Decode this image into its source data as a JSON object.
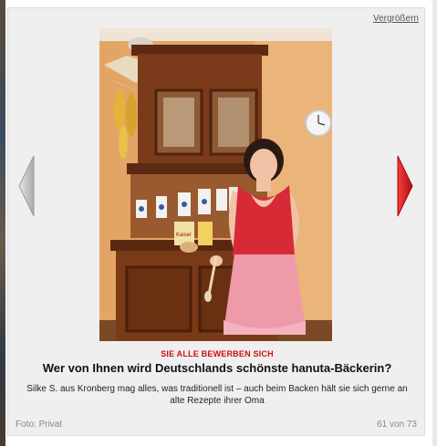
{
  "gallery": {
    "enlarge_label": "Vergrößern",
    "kicker": "SIE ALLE BEWERBEN SICH",
    "title": "Wer von Ihnen wird Deutschlands schönste hanuta-Bäckerin?",
    "description": "Silke S. aus Kronberg mag alles, was traditionell ist – auch beim Backen hält sie sich gerne an alte Rezepte ihrer Oma",
    "photo_credit": "Foto: Privat",
    "counter": "61 von 73",
    "flour_label": "Kaiser"
  },
  "colors": {
    "kicker": "#cc1111",
    "next_arrow": "#d01818",
    "prev_arrow": "#b8b8b8",
    "background": "#efefef"
  }
}
